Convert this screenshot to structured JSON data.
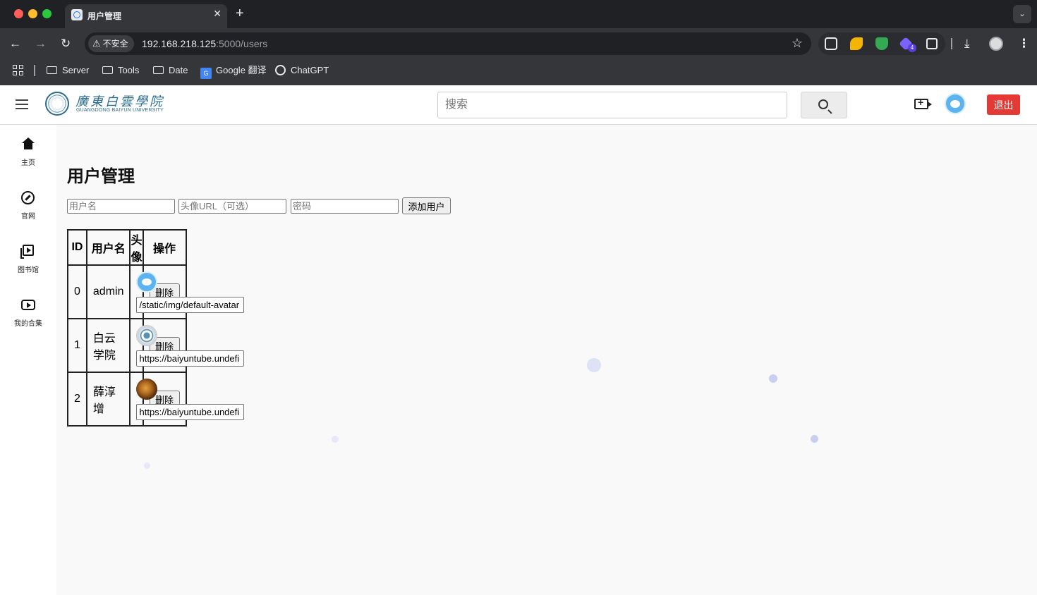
{
  "browser": {
    "tab_title": "用户管理",
    "tab_close": "✕",
    "new_tab": "+",
    "tab_menu": "⌄",
    "security_label": "不安全",
    "url_host": "192.168.218.125",
    "url_path": ":5000/users",
    "ext_badge": "4",
    "bookmarks": [
      {
        "label": "Server",
        "icon": "folder-icon"
      },
      {
        "label": "Tools",
        "icon": "folder-icon"
      },
      {
        "label": "Date",
        "icon": "folder-icon"
      },
      {
        "label": "Google 翻译",
        "icon": "google-translate-icon"
      },
      {
        "label": "ChatGPT",
        "icon": "chatgpt-icon"
      }
    ]
  },
  "header": {
    "logo_name": "廣東白雲學院",
    "logo_en": "GUANGDONG BAIYUN UNIVERSITY",
    "search_placeholder": "搜索",
    "logout_label": "退出"
  },
  "sidebar": {
    "items": [
      {
        "label": "主页",
        "icon": "home-icon"
      },
      {
        "label": "官网",
        "icon": "compass-icon"
      },
      {
        "label": "图书馆",
        "icon": "library-icon"
      },
      {
        "label": "我的合集",
        "icon": "collection-icon"
      }
    ]
  },
  "main": {
    "title": "用户管理",
    "form": {
      "username_placeholder": "用户名",
      "avatar_placeholder": "头像URL（可选）",
      "password_placeholder": "密码",
      "add_label": "添加用户"
    },
    "table": {
      "headers": [
        "ID",
        "用户名",
        "头像",
        "操作"
      ],
      "rows": [
        {
          "id": "0",
          "username": "admin",
          "avatar_url": "/static/img/default-avatar",
          "avatar_icon": "default-avatar",
          "action": "删除"
        },
        {
          "id": "1",
          "username": "白云学院",
          "avatar_url": "https://baiyuntube.undefi",
          "avatar_icon": "school-seal-avatar",
          "action": "删除"
        },
        {
          "id": "2",
          "username": "薛淳增",
          "avatar_url": "https://baiyuntube.undefi",
          "avatar_icon": "tiger-avatar",
          "action": "删除"
        }
      ]
    }
  },
  "colors": {
    "logout_bg": "#e53935",
    "brand": "#2b6c8e",
    "chrome_bg": "#35363a"
  }
}
